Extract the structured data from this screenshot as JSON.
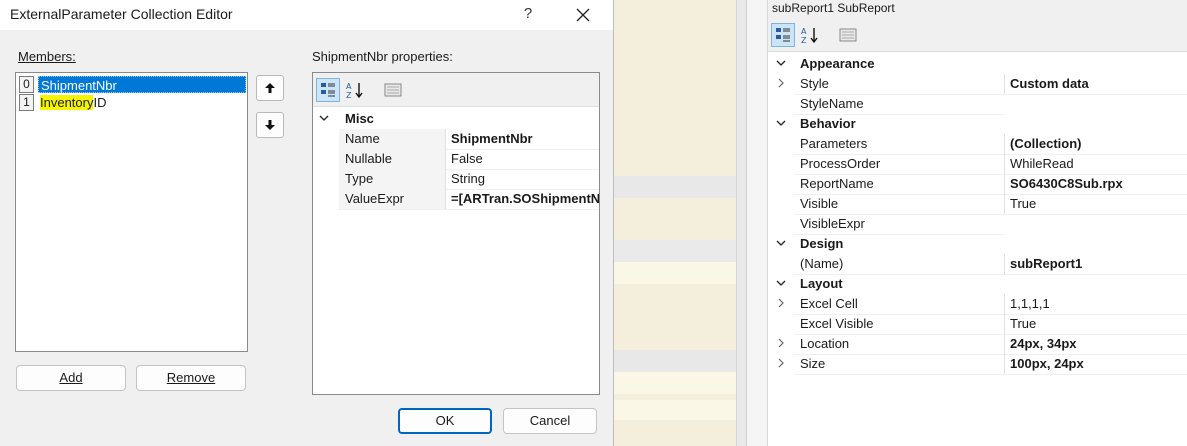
{
  "dialog": {
    "title": "ExternalParameter Collection Editor",
    "help_label": "?",
    "members_label": "Members:",
    "members": [
      {
        "index": "0",
        "name": "ShipmentNbr",
        "selected": true
      },
      {
        "index": "1",
        "name_highlight": "Inventory",
        "name_rest": "ID",
        "selected": false
      }
    ],
    "up_label": "🡅",
    "down_label": "🡇",
    "add_label": "Add",
    "remove_label": "Remove",
    "properties_label": "ShipmentNbr properties:",
    "properties": {
      "category": "Misc",
      "rows": [
        {
          "name": "Name",
          "value": "ShipmentNbr",
          "bold": true
        },
        {
          "name": "Nullable",
          "value": "False",
          "bold": false
        },
        {
          "name": "Type",
          "value": "String",
          "bold": false
        },
        {
          "name": "ValueExpr",
          "value": "=[ARTran.SOShipmentNbr]",
          "bold": true
        }
      ]
    },
    "ok_label": "OK",
    "cancel_label": "Cancel"
  },
  "right_panel": {
    "title": "subReport1 SubReport",
    "categories": [
      {
        "name": "Appearance",
        "rows": [
          {
            "name": "Style",
            "value": "Custom data",
            "bold": true,
            "expandable": true
          },
          {
            "name": "StyleName",
            "value": "",
            "bold": false,
            "expandable": false
          }
        ]
      },
      {
        "name": "Behavior",
        "rows": [
          {
            "name": "Parameters",
            "value": "(Collection)",
            "bold": true,
            "expandable": false
          },
          {
            "name": "ProcessOrder",
            "value": "WhileRead",
            "bold": false,
            "expandable": false
          },
          {
            "name": "ReportName",
            "value": "SO6430C8Sub.rpx",
            "bold": true,
            "expandable": false
          },
          {
            "name": "Visible",
            "value": "True",
            "bold": false,
            "expandable": false
          },
          {
            "name": "VisibleExpr",
            "value": "",
            "bold": false,
            "expandable": false
          }
        ]
      },
      {
        "name": "Design",
        "rows": [
          {
            "name": "(Name)",
            "value": "subReport1",
            "bold": true,
            "expandable": false
          }
        ]
      },
      {
        "name": "Layout",
        "rows": [
          {
            "name": "Excel Cell",
            "value": "1,1,1,1",
            "bold": false,
            "expandable": true
          },
          {
            "name": "Excel Visible",
            "value": "True",
            "bold": false,
            "expandable": false
          },
          {
            "name": "Location",
            "value": "24px, 34px",
            "bold": true,
            "expandable": true
          },
          {
            "name": "Size",
            "value": "100px, 24px",
            "bold": true,
            "expandable": true
          }
        ]
      }
    ]
  },
  "colors": {
    "selection": "#0078d7",
    "highlight": "#f5f500",
    "ok_border": "#0067c0"
  }
}
